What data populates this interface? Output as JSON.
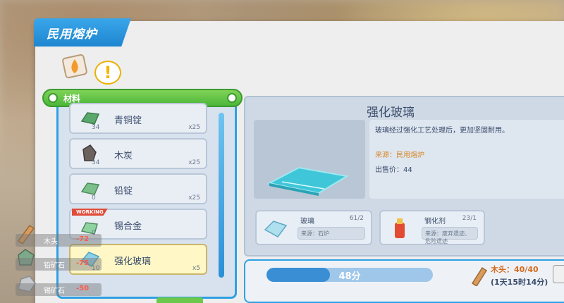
{
  "window": {
    "title": "民用熔炉"
  },
  "tabs": {
    "alert_symbol": "!"
  },
  "materials_header": "材料",
  "items": [
    {
      "name": "青铜锭",
      "qty": "34",
      "mult": "x25"
    },
    {
      "name": "木炭",
      "qty": "34",
      "mult": "x25"
    },
    {
      "name": "铅锭",
      "qty": "0",
      "mult": "x25"
    },
    {
      "name": "锡合金",
      "qty": "0",
      "mult": "",
      "tag": "WORKING"
    },
    {
      "name": "强化玻璃",
      "qty": "10",
      "mult": "x5"
    }
  ],
  "detail": {
    "title": "强化玻璃",
    "description": "玻璃经过强化工艺处理后，更加坚固耐用。",
    "source": "来源：民用熔炉",
    "price": "出售价：44"
  },
  "requirements": [
    {
      "name": "玻璃",
      "count": "61/2",
      "source": "来源：石炉"
    },
    {
      "name": "钢化剂",
      "count": "23/1",
      "source": "来源：废弃遗迹、危险遗迹"
    }
  ],
  "craft": {
    "time_label": "48分",
    "progress": 0.38,
    "fuel_text": "木头：40/40",
    "fuel_time": "(1天15时14分)"
  },
  "inventory": [
    {
      "name": "木头",
      "value": "-72"
    },
    {
      "name": "铅矿石",
      "value": "-75"
    },
    {
      "name": "锡矿石",
      "value": "-50"
    }
  ],
  "colors": {
    "accent": "#2ea1e2",
    "header_green": "#4cb63a",
    "selected": "#fff8c6",
    "fuel": "#d46b1e"
  }
}
